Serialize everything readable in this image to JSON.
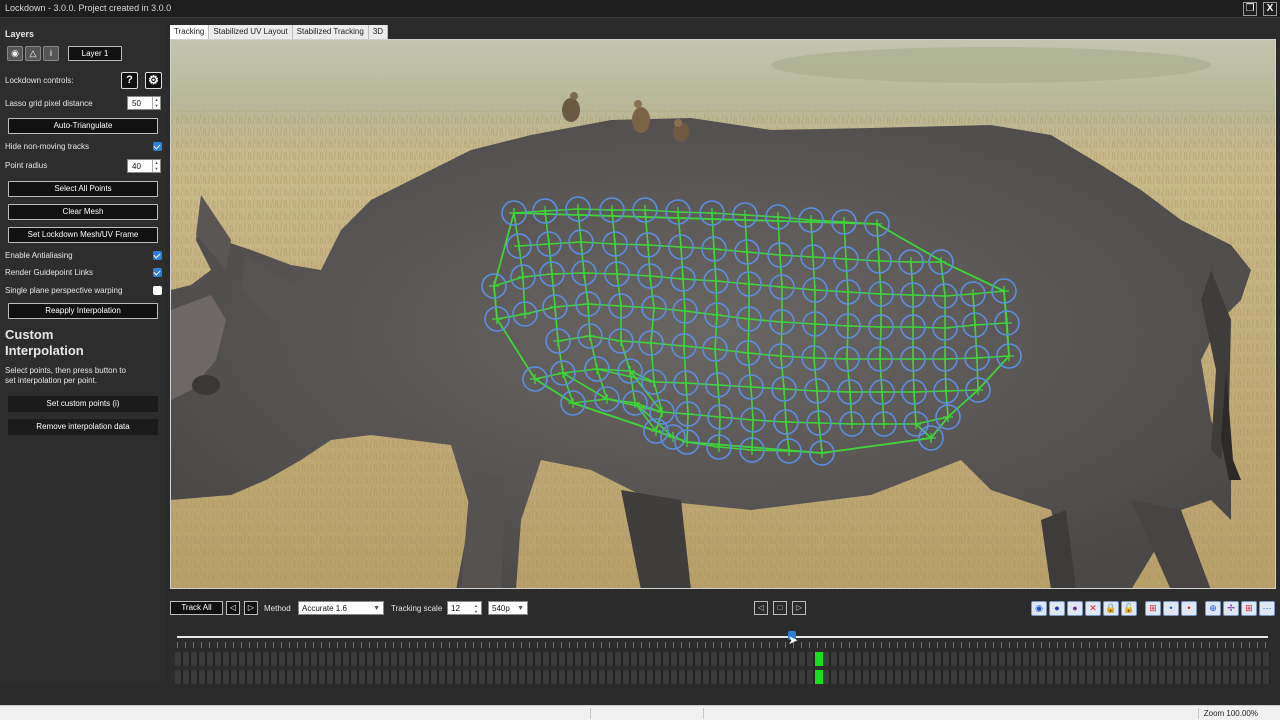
{
  "window": {
    "title": "Lockdown - 3.0.0. Project created in 3.0.0",
    "restore_icon": "restore-icon",
    "close_label": "X"
  },
  "layers": {
    "heading": "Layers",
    "layer_name": "Layer 1",
    "icons": [
      "eye-icon",
      "triangle-icon",
      "info-icon"
    ]
  },
  "controls": {
    "lockdown_label": "Lockdown controls:",
    "help_label": "?",
    "lasso_label": "Lasso grid pixel distance",
    "lasso_value": "50",
    "auto_triangulate": "Auto-Triangulate",
    "hide_tracks_label": "Hide non-moving tracks",
    "hide_tracks_checked": true,
    "point_radius_label": "Point radius",
    "point_radius_value": "40",
    "select_all": "Select All Points",
    "clear_mesh": "Clear Mesh",
    "set_lockdown": "Set Lockdown Mesh/UV Frame",
    "antialiasing_label": "Enable Antialiasing",
    "antialiasing_checked": true,
    "guidepoint_label": "Render Guidepoint Links",
    "guidepoint_checked": true,
    "single_plane_label": "Single plane perspective warping",
    "single_plane_checked": false,
    "reapply": "Reapply Interpolation"
  },
  "custom_interp": {
    "heading": "Custom Interpolation",
    "hint": "Select points, then press button to set interpolation per point.",
    "set_points": "Set custom points (i)",
    "remove_data": "Remove interpolation data"
  },
  "tabs": [
    "Tracking",
    "Stabilized UV Layout",
    "Stabilized Tracking",
    "3D"
  ],
  "active_tab": "Tracking",
  "toolbar": {
    "track_all": "Track All",
    "method_label": "Method",
    "method_value": "Accurate 1.6",
    "tracking_scale_label": "Tracking scale",
    "tracking_scale_value": "12",
    "resolution_value": "540p"
  },
  "timeline": {
    "playhead_position": 0.56,
    "keyframe_marker_color": "#17e01a"
  },
  "status": {
    "zoom": "Zoom 100.00%"
  },
  "colors": {
    "accent_blue": "#2e7fd6",
    "mesh_green": "#3fd43a",
    "point_blue": "#5b8fe0"
  }
}
